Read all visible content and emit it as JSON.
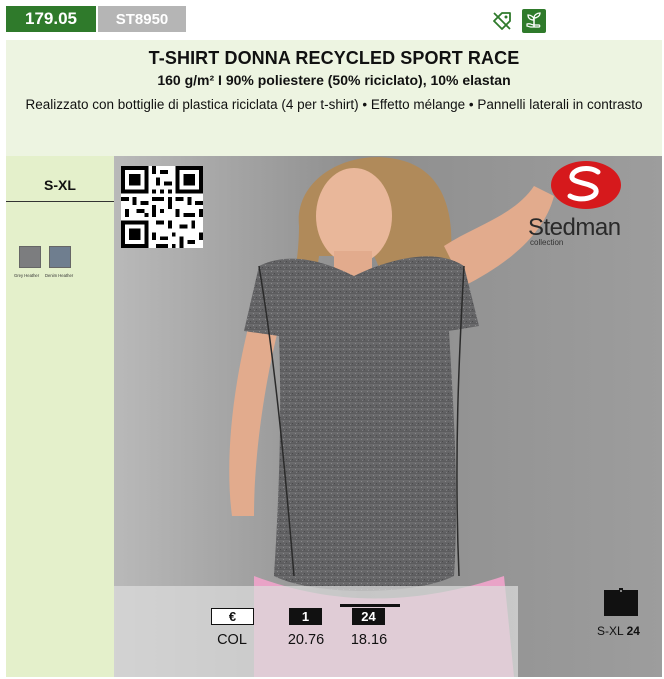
{
  "header": {
    "page_code": "179.05",
    "sku": "ST8950",
    "badges": [
      "recycled-tag-icon",
      "eco-plant-icon"
    ],
    "colors": {
      "accent_green": "#2f7a2b",
      "band": "#edf4e1",
      "side": "#e4f0cb",
      "sku_grey": "#b5b5b5"
    }
  },
  "product": {
    "title": "T-SHIRT DONNA RECYCLED SPORT RACE",
    "specs": "160 g/m² I 90% poliestere (50% riciclato), 10% elastan",
    "description": "Realizzato con bottiglie di plastica riciclata (4 per t-shirt) • Effetto mélange • Pannelli laterali in contrasto"
  },
  "sidebar": {
    "sizes": "S-XL",
    "colors": [
      {
        "name": "Grey Heather",
        "hex": "#7c7d7f"
      },
      {
        "name": "Denim Heather",
        "hex": "#6f7e8f"
      }
    ]
  },
  "brand": {
    "name": "Stedman",
    "sub": "collection"
  },
  "pricing": {
    "currency_label": "€",
    "qty_1_label": "1",
    "qty_24_label": "24",
    "row_label": "COL",
    "price_1": "20.76",
    "price_24": "18.16"
  },
  "packaging": {
    "sizes": "S-XL",
    "qty": "24"
  }
}
